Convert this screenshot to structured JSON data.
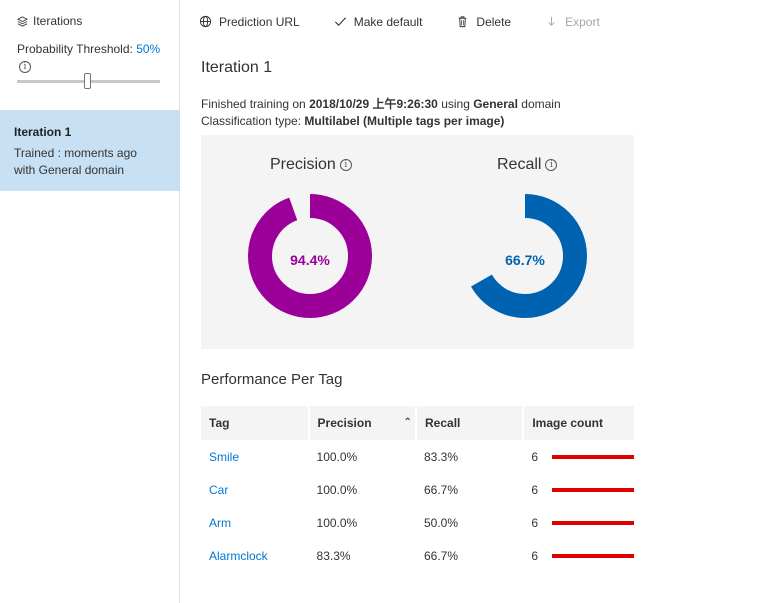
{
  "sidebar": {
    "header_label": "Iterations",
    "threshold_label": "Probability Threshold:",
    "threshold_value": "50%",
    "threshold_fraction": 0.5,
    "iteration": {
      "title": "Iteration 1",
      "line1": "Trained : moments ago",
      "line2": "with General domain"
    }
  },
  "toolbar": {
    "prediction_url": "Prediction URL",
    "make_default": "Make default",
    "delete": "Delete",
    "export": "Export"
  },
  "main": {
    "title": "Iteration 1",
    "meta": {
      "finished_prefix": "Finished training on",
      "date": "2018/10/29 上午9:26:30",
      "using": "using",
      "domain": "General",
      "domain_suffix": "domain",
      "class_prefix": "Classification type:",
      "class_type": "Multilabel (Multiple tags per image)"
    },
    "precision": {
      "label": "Precision",
      "value": "94.4%",
      "fraction": 0.944,
      "color": "#9b0099"
    },
    "recall": {
      "label": "Recall",
      "value": "66.7%",
      "fraction": 0.667,
      "color": "#0063b1"
    },
    "perf_title": "Performance Per Tag",
    "table": {
      "headers": [
        "Tag",
        "Precision",
        "Recall",
        "Image count"
      ],
      "rows": [
        {
          "tag": "Smile",
          "precision": "100.0%",
          "recall": "83.3%",
          "count": "6"
        },
        {
          "tag": "Car",
          "precision": "100.0%",
          "recall": "66.7%",
          "count": "6"
        },
        {
          "tag": "Arm",
          "precision": "100.0%",
          "recall": "50.0%",
          "count": "6"
        },
        {
          "tag": "Alarmclock",
          "precision": "83.3%",
          "recall": "66.7%",
          "count": "6"
        }
      ],
      "bar_color": "#e00000"
    }
  }
}
